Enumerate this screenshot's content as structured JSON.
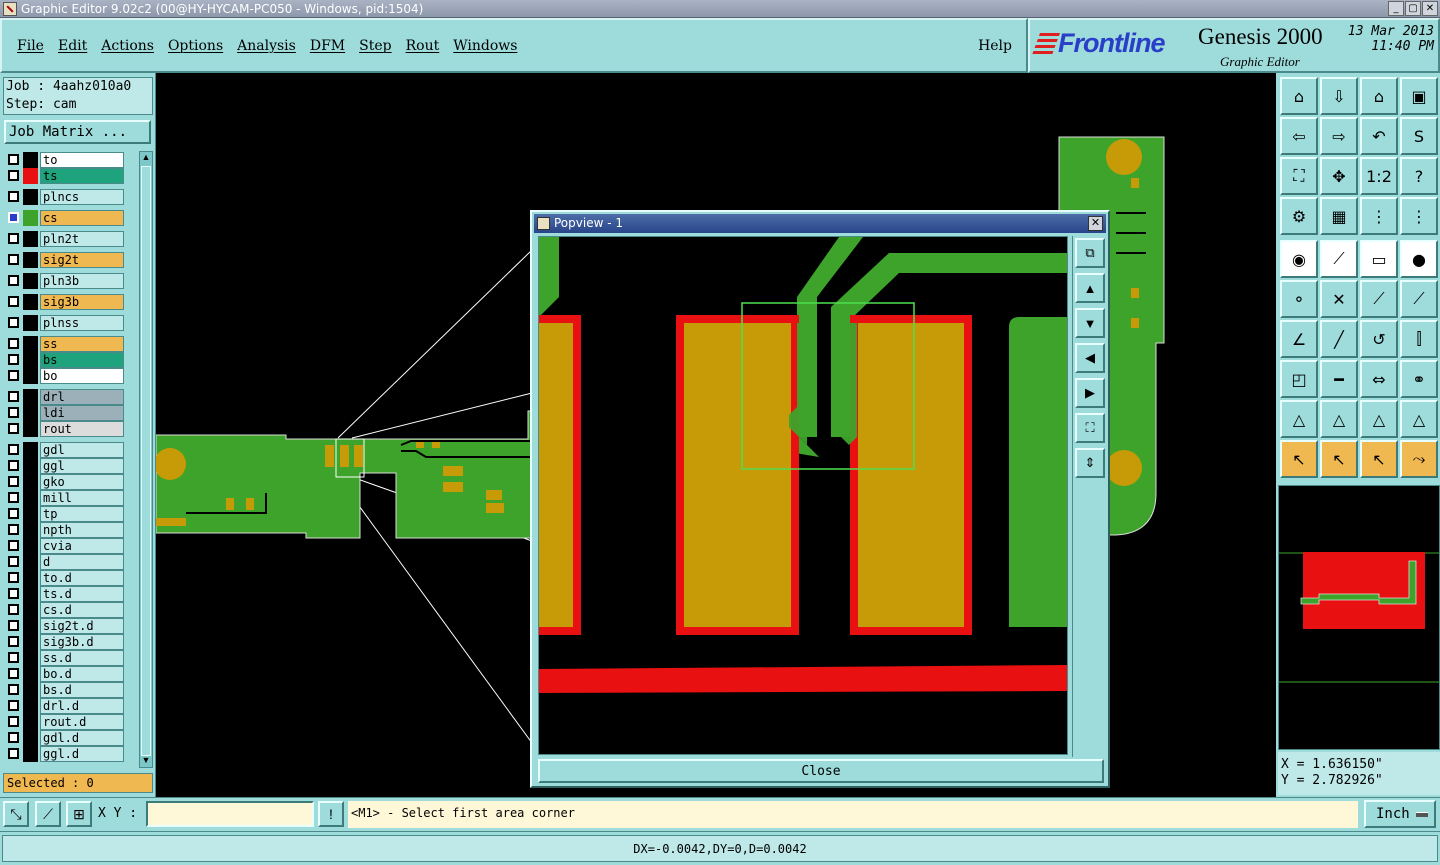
{
  "window": {
    "title": "Graphic Editor 9.02c2 (00@HY-HYCAM-PC050 - Windows, pid:1504)"
  },
  "menu": {
    "items": [
      "File",
      "Edit",
      "Actions",
      "Options",
      "Analysis",
      "DFM",
      "Step",
      "Rout",
      "Windows"
    ],
    "help": "Help"
  },
  "brand": {
    "logo": "Frontline",
    "product": "Genesis 2000",
    "subtitle": "Graphic Editor",
    "date": "13 Mar 2013",
    "time": "11:40 PM"
  },
  "job": {
    "job_line": "Job : 4aahz010a0",
    "step_line": "Step: cam",
    "matrix_button": "Job Matrix ..."
  },
  "layers": [
    {
      "name": "to",
      "bg": "#ffffff",
      "swatch": "#000000"
    },
    {
      "name": "ts",
      "bg": "#1fa37c",
      "swatch": "#e81010"
    },
    {
      "name": "plncs",
      "bg": "#bfe8e8",
      "swatch": "#000000"
    },
    {
      "name": "cs",
      "bg": "#f0b850",
      "swatch": "#3ea32a",
      "active": true
    },
    {
      "name": "pln2t",
      "bg": "#bfe8e8",
      "swatch": "#000000"
    },
    {
      "name": "sig2t",
      "bg": "#f0b850",
      "swatch": "#000000"
    },
    {
      "name": "pln3b",
      "bg": "#bfe8e8",
      "swatch": "#000000"
    },
    {
      "name": "sig3b",
      "bg": "#f0b850",
      "swatch": "#000000"
    },
    {
      "name": "plnss",
      "bg": "#bfe8e8",
      "swatch": "#000000"
    },
    {
      "name": "ss",
      "bg": "#f0b850",
      "swatch": "#000000"
    },
    {
      "name": "bs",
      "bg": "#1fa37c",
      "swatch": "#000000"
    },
    {
      "name": "bo",
      "bg": "#ffffff",
      "swatch": "#000000"
    },
    {
      "name": "drl",
      "bg": "#9bb0b8",
      "swatch": "#000000"
    },
    {
      "name": "ldi",
      "bg": "#9bb0b8",
      "swatch": "#000000"
    },
    {
      "name": "rout",
      "bg": "#dcdcdc",
      "swatch": "#000000"
    },
    {
      "name": "gdl",
      "bg": "#bfe8e8",
      "swatch": "#000000"
    },
    {
      "name": "ggl",
      "bg": "#bfe8e8",
      "swatch": "#000000"
    },
    {
      "name": "gko",
      "bg": "#bfe8e8",
      "swatch": "#000000"
    },
    {
      "name": "mill",
      "bg": "#bfe8e8",
      "swatch": "#000000"
    },
    {
      "name": "tp",
      "bg": "#bfe8e8",
      "swatch": "#000000"
    },
    {
      "name": "npth",
      "bg": "#bfe8e8",
      "swatch": "#000000"
    },
    {
      "name": "cvia",
      "bg": "#bfe8e8",
      "swatch": "#000000"
    },
    {
      "name": "d",
      "bg": "#bfe8e8",
      "swatch": "#000000"
    },
    {
      "name": "to.d",
      "bg": "#bfe8e8",
      "swatch": "#000000"
    },
    {
      "name": "ts.d",
      "bg": "#bfe8e8",
      "swatch": "#000000"
    },
    {
      "name": "cs.d",
      "bg": "#bfe8e8",
      "swatch": "#000000"
    },
    {
      "name": "sig2t.d",
      "bg": "#bfe8e8",
      "swatch": "#000000"
    },
    {
      "name": "sig3b.d",
      "bg": "#bfe8e8",
      "swatch": "#000000"
    },
    {
      "name": "ss.d",
      "bg": "#bfe8e8",
      "swatch": "#000000"
    },
    {
      "name": "bo.d",
      "bg": "#bfe8e8",
      "swatch": "#000000"
    },
    {
      "name": "bs.d",
      "bg": "#bfe8e8",
      "swatch": "#000000"
    },
    {
      "name": "drl.d",
      "bg": "#bfe8e8",
      "swatch": "#000000"
    },
    {
      "name": "rout.d",
      "bg": "#bfe8e8",
      "swatch": "#000000"
    },
    {
      "name": "gdl.d",
      "bg": "#bfe8e8",
      "swatch": "#000000"
    },
    {
      "name": "ggl.d",
      "bg": "#bfe8e8",
      "swatch": "#000000"
    }
  ],
  "selected": "Selected : 0",
  "coords": {
    "x": "X = 1.636150\"",
    "y": "Y = 2.782926\""
  },
  "popview": {
    "title": "Popview - 1",
    "close": "Close"
  },
  "bottom": {
    "xy_label": "X Y :",
    "message": "<M1> - Select first area corner",
    "units": "Inch"
  },
  "status": "DX=-0.0042,DY=0,D=0.0042",
  "colors": {
    "panel": "#9edcdc",
    "copper": "#3ea32a",
    "pad": "#c79a08",
    "mask": "#e81010"
  }
}
